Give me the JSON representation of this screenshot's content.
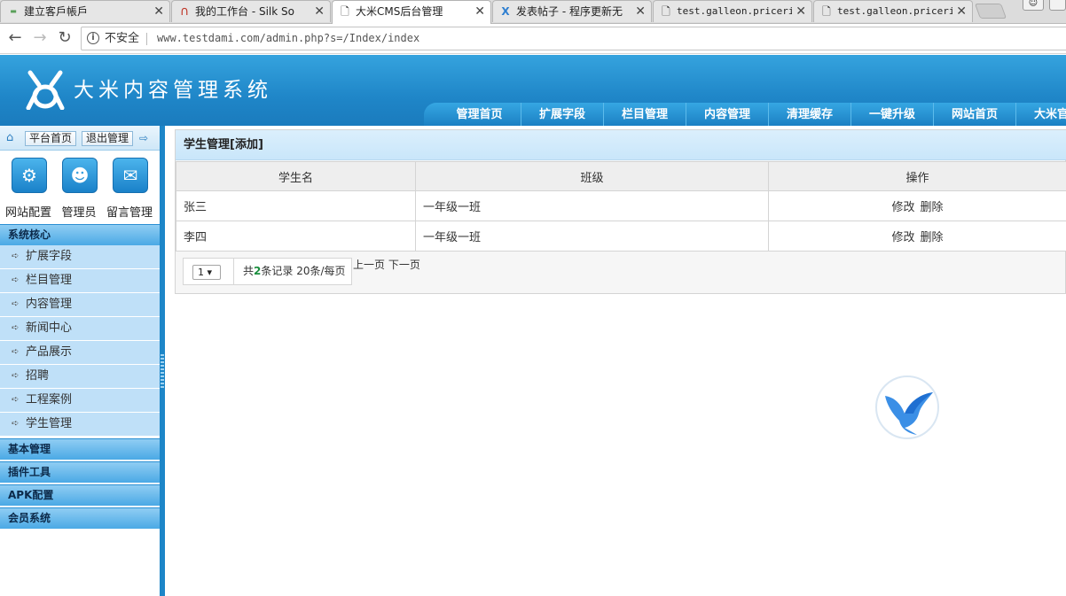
{
  "browser": {
    "tabs": [
      {
        "title": "建立客戶帳戶",
        "icon": "account-icon",
        "active": false
      },
      {
        "title": "我的工作台 - Silk So",
        "icon": "silk-icon",
        "active": false
      },
      {
        "title": "大米CMS后台管理",
        "icon": "page-icon",
        "active": true
      },
      {
        "title": "发表帖子 - 程序更新无",
        "icon": "forum-icon",
        "active": false
      },
      {
        "title": "test.galleon.priceri",
        "icon": "page-icon",
        "active": false
      },
      {
        "title": "test.galleon.priceri",
        "icon": "page-icon",
        "active": false
      }
    ],
    "security_label": "不安全",
    "url": "www.testdami.com/admin.php?s=/Index/index"
  },
  "header": {
    "site_title": "大米内容管理系统",
    "nav": [
      "管理首页",
      "扩展字段",
      "栏目管理",
      "内容管理",
      "清理缓存",
      "一键升级",
      "网站首页",
      "大米官"
    ]
  },
  "sidebar": {
    "top_buttons": {
      "platform_home": "平台首页",
      "logout": "退出管理"
    },
    "quick_links": [
      {
        "label": "网站配置",
        "icon": "gear-icon"
      },
      {
        "label": "管理员",
        "icon": "admin-badge-icon"
      },
      {
        "label": "留言管理",
        "icon": "message-board-icon"
      }
    ],
    "sections": [
      {
        "title": "系统核心",
        "items": [
          "扩展字段",
          "栏目管理",
          "内容管理",
          "新闻中心",
          "产品展示",
          "招聘",
          "工程案例",
          "学生管理"
        ]
      },
      {
        "title": "基本管理",
        "items": []
      },
      {
        "title": "插件工具",
        "items": []
      },
      {
        "title": "APK配置",
        "items": []
      },
      {
        "title": "会员系统",
        "items": []
      }
    ]
  },
  "main": {
    "header": "学生管理[添加]",
    "columns": [
      "学生名",
      "班级",
      "操作"
    ],
    "rows": [
      {
        "name": "张三",
        "class": "一年级一班",
        "edit": "修改",
        "delete": "删除"
      },
      {
        "name": "李四",
        "class": "一年级一班",
        "edit": "修改",
        "delete": "删除"
      }
    ],
    "pager": {
      "page_select": "1",
      "info_prefix": "共",
      "total": "2",
      "info_suffix": "条记录 20条/每页",
      "prev": "上一页",
      "next": "下一页"
    }
  },
  "colors": {
    "brand_blue": "#1f86c8",
    "sidebar_item_bg": "#bfe0f8",
    "count_green": "#1a8e3e"
  }
}
